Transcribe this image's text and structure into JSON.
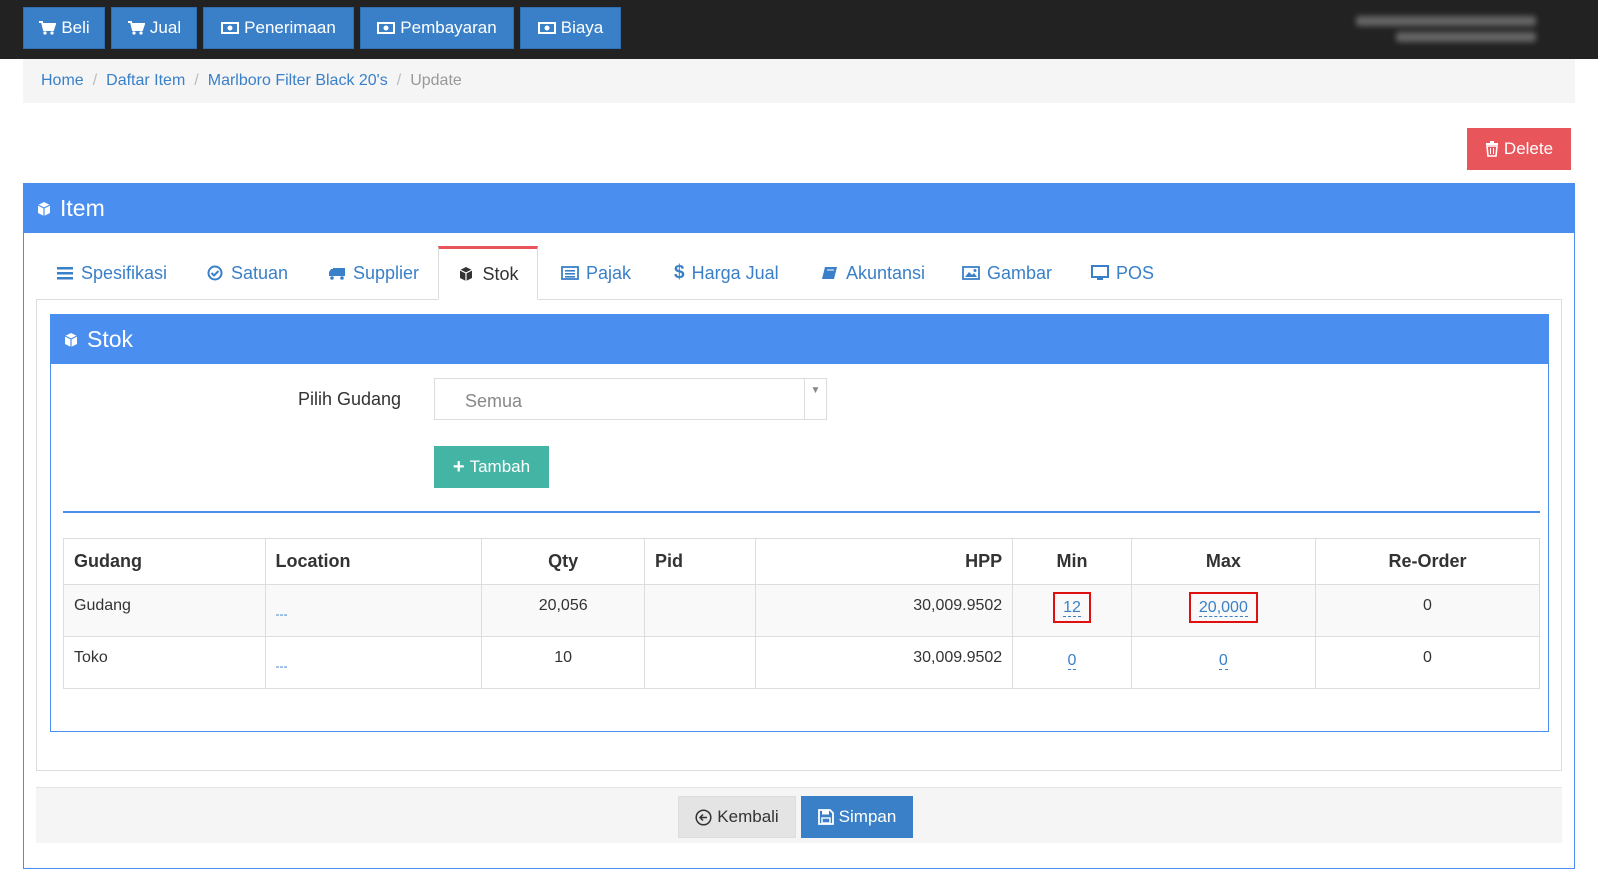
{
  "topnav": [
    {
      "label": "Beli",
      "icon": "cart-icon"
    },
    {
      "label": "Jual",
      "icon": "cart-icon"
    },
    {
      "label": "Penerimaan",
      "icon": "money-icon"
    },
    {
      "label": "Pembayaran",
      "icon": "money-icon"
    },
    {
      "label": "Biaya",
      "icon": "money-icon"
    }
  ],
  "breadcrumb": {
    "home": "Home",
    "daftar_item": "Daftar Item",
    "item_name": "Marlboro Filter Black 20's",
    "current": "Update"
  },
  "delete_label": "Delete",
  "panel_title": "Item",
  "tabs": [
    {
      "label": "Spesifikasi",
      "icon": "list-icon"
    },
    {
      "label": "Satuan",
      "icon": "check-circle-icon"
    },
    {
      "label": "Supplier",
      "icon": "truck-icon"
    },
    {
      "label": "Stok",
      "icon": "cube-icon"
    },
    {
      "label": "Pajak",
      "icon": "list-alt-icon"
    },
    {
      "label": "Harga Jual",
      "icon": "dollar-icon"
    },
    {
      "label": "Akuntansi",
      "icon": "book-icon"
    },
    {
      "label": "Gambar",
      "icon": "picture-icon"
    },
    {
      "label": "POS",
      "icon": "monitor-icon"
    }
  ],
  "active_tab": "Stok",
  "stok": {
    "title": "Stok",
    "pilih_gudang_label": "Pilih Gudang",
    "pilih_gudang_value": "Semua",
    "tambah_label": "Tambah",
    "columns": [
      "Gudang",
      "Location",
      "Qty",
      "Pid",
      "HPP",
      "Min",
      "Max",
      "Re-Order"
    ],
    "rows": [
      {
        "gudang": "Gudang",
        "location": "---",
        "qty": "20,056",
        "pid": "",
        "hpp": "30,009.9502",
        "min": "12",
        "max": "20,000",
        "reorder": "0"
      },
      {
        "gudang": "Toko",
        "location": "---",
        "qty": "10",
        "pid": "",
        "hpp": "30,009.9502",
        "min": "0",
        "max": "0",
        "reorder": "0"
      }
    ]
  },
  "footer": {
    "kembali_label": "Kembali",
    "simpan_label": "Simpan"
  },
  "colors": {
    "topbar": "#222222",
    "nav_button": "#3a80c8",
    "panel_header": "#4a8ff0",
    "delete": "#e8555a",
    "tambah": "#44b5a4",
    "highlight_box": "#e01010"
  }
}
